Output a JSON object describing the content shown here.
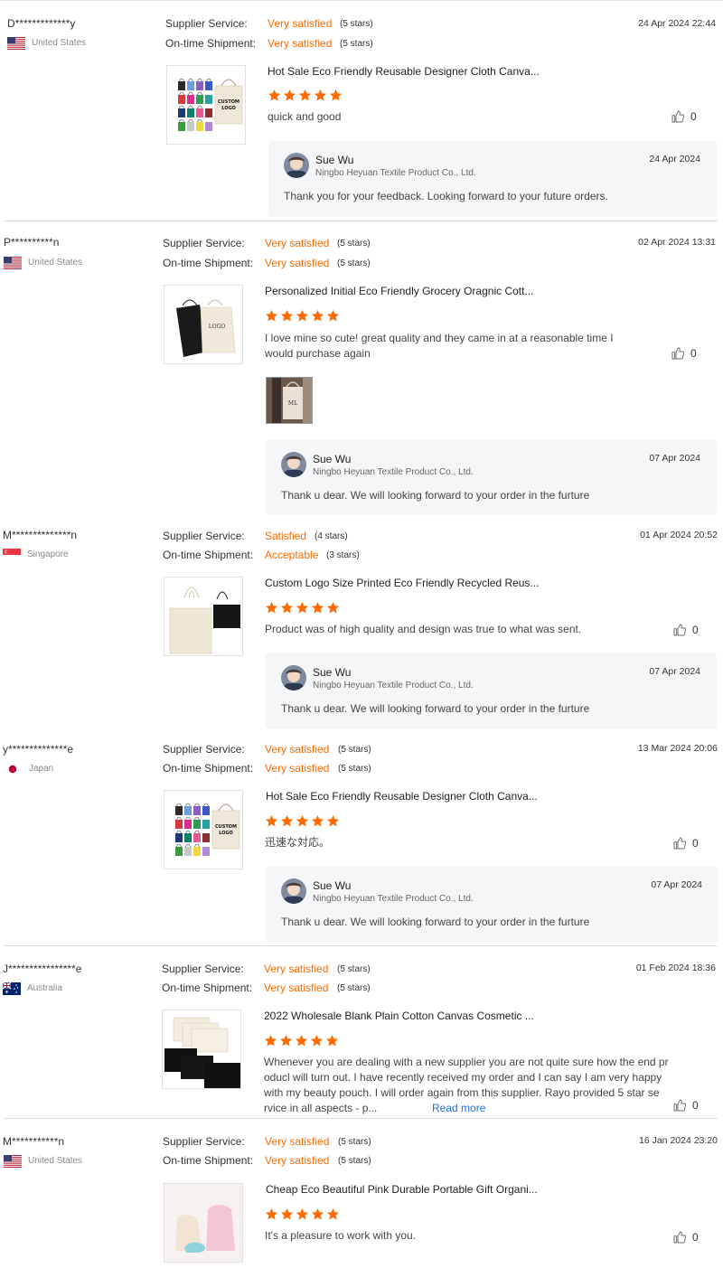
{
  "labels": {
    "supplier_service": "Supplier Service:",
    "on_time_shipment": "On-time Shipment:",
    "read_more": "Read more"
  },
  "colors": {
    "accent": "#ff6a00",
    "link": "#1a73e8",
    "reply_bg": "#f5f6f8"
  },
  "reviews": [
    {
      "user": "D*************y",
      "country": "United States",
      "flag": "us-flag-icon",
      "supplier_service": {
        "value": "Very satisfied",
        "stars": "(5 stars)"
      },
      "on_time_shipment": {
        "value": "Very satisfied",
        "stars": "(5 stars)"
      },
      "date": "24 Apr 2024 22:44",
      "product_title": "Hot Sale Eco Friendly Reusable Designer Cloth Canva...",
      "rating": 5,
      "comment": "quick and good",
      "likes": "0",
      "reply": {
        "name": "Sue Wu",
        "company": "Ningbo Heyuan Textile Product Co., Ltd.",
        "date": "24 Apr 2024",
        "text": "Thank you for your feedback. Looking forward to your future orders."
      }
    },
    {
      "user": "P**********n",
      "country": "United States",
      "flag": "us-flag-icon",
      "supplier_service": {
        "value": "Very satisfied",
        "stars": "(5 stars)"
      },
      "on_time_shipment": {
        "value": "Very satisfied",
        "stars": "(5 stars)"
      },
      "date": "02 Apr 2024 13:31",
      "product_title": "Personalized Initial Eco Friendly Grocery Oragnic Cott...",
      "rating": 5,
      "comment_line1": "I love mine so cute! great quality and they came in at a reasonable time I",
      "comment_line2": "would purchase again",
      "likes": "0",
      "reply": {
        "name": "Sue Wu",
        "company": "Ningbo Heyuan Textile Product Co., Ltd.",
        "date": "07 Apr 2024",
        "text": "Thank u dear. We will looking forward to your order in the furture"
      }
    },
    {
      "user": "M**************n",
      "country": "Singapore",
      "flag": "sg-flag-icon",
      "supplier_service": {
        "value": "Satisfied",
        "stars": "(4 stars)"
      },
      "on_time_shipment": {
        "value": "Acceptable",
        "stars": "(3 stars)"
      },
      "date": "01 Apr 2024 20:52",
      "product_title": "Custom Logo Size Printed Eco Friendly Recycled Reus...",
      "rating": 5,
      "comment": "Product was of high quality and design was true to what was sent.",
      "likes": "0",
      "reply": {
        "name": "Sue Wu",
        "company": "Ningbo Heyuan Textile Product Co., Ltd.",
        "date": "07 Apr 2024",
        "text": "Thank u dear. We will looking forward to your order in the furture"
      }
    },
    {
      "user": "y**************e",
      "country": "Japan",
      "flag": "jp-flag-icon",
      "supplier_service": {
        "value": "Very satisfied",
        "stars": "(5 stars)"
      },
      "on_time_shipment": {
        "value": "Very satisfied",
        "stars": "(5 stars)"
      },
      "date": "13 Mar 2024 20:06",
      "product_title": "Hot Sale Eco Friendly Reusable Designer Cloth Canva...",
      "rating": 5,
      "comment": "迅速な対応。",
      "likes": "0",
      "reply": {
        "name": "Sue Wu",
        "company": "Ningbo Heyuan Textile Product Co., Ltd.",
        "date": "07 Apr 2024",
        "text": "Thank u dear. We will looking forward to your order in the furture"
      }
    },
    {
      "user": "J****************e",
      "country": "Australia",
      "flag": "au-flag-icon",
      "supplier_service": {
        "value": "Very satisfied",
        "stars": "(5 stars)"
      },
      "on_time_shipment": {
        "value": "Very satisfied",
        "stars": "(5 stars)"
      },
      "date": "01 Feb 2024 18:36",
      "product_title": "2022 Wholesale Blank Plain Cotton Canvas Cosmetic ...",
      "rating": 5,
      "comment_line1": "Whenever you are dealing with a new supplier you are not quite sure how the end pr",
      "comment_line2": "oducl will turn out. I have recently received my order and I can say  I am very happy",
      "comment_line3": "with my beauty pouch. I   will order again from this supplier. Rayo  provided 5 star se",
      "comment_line4": "rvice in all aspects -  p...",
      "likes": "0"
    },
    {
      "user": "M***********n",
      "country": "United States",
      "flag": "us-flag-icon",
      "supplier_service": {
        "value": "Very satisfied",
        "stars": "(5 stars)"
      },
      "on_time_shipment": {
        "value": "Very satisfied",
        "stars": "(5 stars)"
      },
      "date": "16 Jan 2024 23:20",
      "product_title": "Cheap Eco Beautiful Pink Durable Portable Gift Organi...",
      "rating": 5,
      "comment": "It's a pleasure to work with you.",
      "likes": "0"
    }
  ]
}
